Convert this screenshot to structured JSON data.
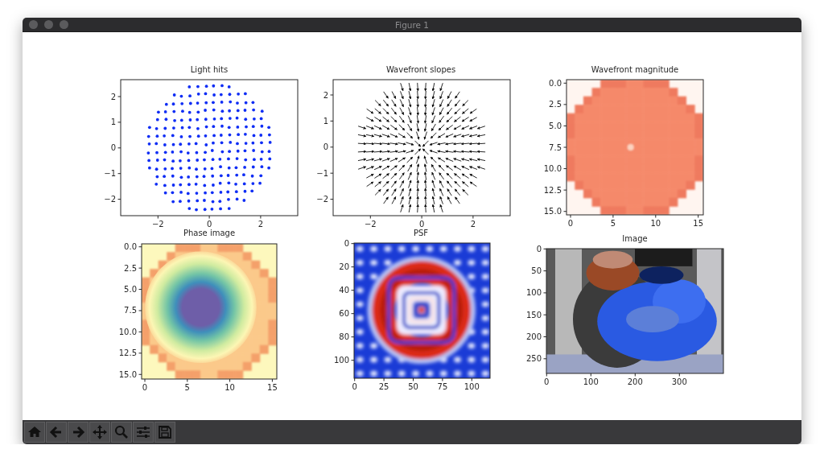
{
  "window": {
    "title": "Figure 1"
  },
  "panels": [
    {
      "kind": "scatter",
      "title": "Light hits",
      "xticks": [
        "−2",
        "0",
        "2"
      ],
      "yticks": [
        "2",
        "1",
        "0",
        "−1",
        "−2"
      ]
    },
    {
      "kind": "quiver",
      "title": "Wavefront slopes",
      "xticks": [
        "−2",
        "0",
        "2"
      ],
      "yticks": [
        "2",
        "1",
        "0",
        "−1",
        "−2"
      ]
    },
    {
      "kind": "magnitude",
      "title": "Wavefront magnitude",
      "xticks": [
        "0",
        "5",
        "10",
        "15"
      ],
      "yticks": [
        "0.0",
        "2.5",
        "5.0",
        "7.5",
        "10.0",
        "12.5",
        "15.0"
      ]
    },
    {
      "kind": "phase",
      "title": "Phase image",
      "xticks": [
        "0",
        "5",
        "10",
        "15"
      ],
      "yticks": [
        "0.0",
        "2.5",
        "5.0",
        "7.5",
        "10.0",
        "12.5",
        "15.0"
      ]
    },
    {
      "kind": "psf",
      "title": "PSF",
      "xticks": [
        "0",
        "25",
        "50",
        "75",
        "100"
      ],
      "yticks": [
        "0",
        "20",
        "40",
        "60",
        "80",
        "100"
      ]
    },
    {
      "kind": "picture",
      "title": "Image",
      "xticks": [
        "0",
        "100",
        "200",
        "300"
      ],
      "yticks": [
        "0",
        "50",
        "100",
        "150",
        "200",
        "250"
      ]
    }
  ]
}
